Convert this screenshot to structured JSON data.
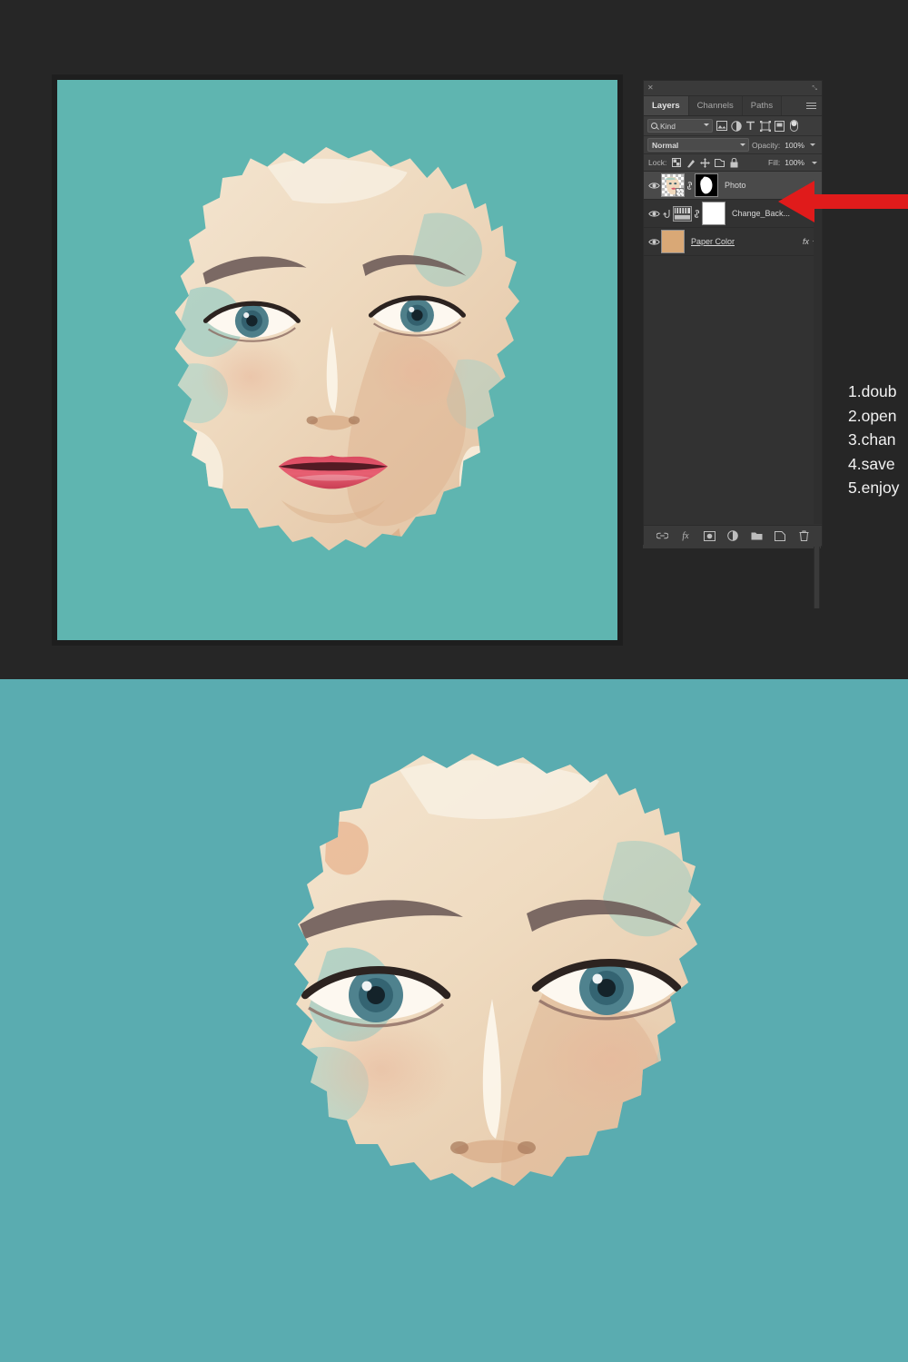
{
  "theme": {
    "app_background": "#262626",
    "canvas_teal": "#5fb5b0",
    "poster_teal": "#5aacb0",
    "panel_background": "#323232",
    "panel_header": "#3a3a3a",
    "selected_row": "#4a4a4a",
    "arrow_red": "#e01b1b",
    "paper_color_swatch": "#d9a876",
    "skin_light": "#f3e4cf",
    "skin_mid": "#e2bf9c",
    "lip_red": "#e2596b",
    "brow_dark": "#6b5a58"
  },
  "panel": {
    "name": "Layers",
    "close_glyph": "✕",
    "collapse_glyph": "⤡",
    "menu_icon": "hamburger-menu-icon",
    "tabs": [
      {
        "label": "Layers",
        "active": true
      },
      {
        "label": "Channels",
        "active": false
      },
      {
        "label": "Paths",
        "active": false
      }
    ],
    "filter_row": {
      "kind_label": "Kind",
      "search_icon": "magnifier-icon",
      "chevron": "chevron-down-icon",
      "filter_icons": [
        "pixel-layer-filter-icon",
        "adjustment-layer-filter-icon",
        "type-layer-filter-icon",
        "shape-layer-filter-icon",
        "smart-object-filter-icon"
      ],
      "toggle_icon": "filter-toggle-switch-icon"
    },
    "blend_row": {
      "blend_mode": "Normal",
      "opacity_label": "Opacity:",
      "opacity_value": "100%"
    },
    "lock_row": {
      "lock_label": "Lock:",
      "lock_icons": [
        "lock-transparent-pixels-icon",
        "lock-image-pixels-icon",
        "lock-position-icon",
        "lock-artboard-nesting-icon",
        "lock-all-icon"
      ],
      "fill_label": "Fill:",
      "fill_value": "100%"
    },
    "layers": [
      {
        "name": "Photo",
        "selected": true,
        "visible": true,
        "visibility_icon": "eye-icon",
        "thumbnail": "photo-layer-thumbnail",
        "link_icon": "link-icon",
        "mask": "layer-mask-thumbnail",
        "has_fx": false,
        "underline": false
      },
      {
        "name": "Change_Back...",
        "selected": false,
        "visible": true,
        "visibility_icon": "eye-icon",
        "thumbnail": "gradient-map-adjustment-thumbnail",
        "clip_icon": "clipping-mask-icon",
        "link_icon": "link-icon",
        "mask": "white-layer-mask-thumbnail",
        "has_fx": false,
        "underline": false
      },
      {
        "name": "Paper Color",
        "selected": false,
        "visible": true,
        "visibility_icon": "eye-icon",
        "thumbnail": "solid-color-swatch-thumbnail",
        "swatch_color": "#d9a876",
        "has_fx": true,
        "fx_label": "fx",
        "fx_chevron": "chevron-down-icon",
        "underline": true
      }
    ],
    "bottom_toolbar": [
      "link-layers-icon",
      "add-layer-style-fx-icon",
      "add-layer-mask-icon",
      "new-adjustment-layer-icon",
      "new-group-icon",
      "new-layer-icon",
      "delete-layer-icon"
    ]
  },
  "annotation": {
    "arrow": "left-pointing-red-arrow",
    "arrow_target": "Photo layer row",
    "steps": [
      "1.doub",
      "2.open",
      "3.chan",
      "4.save",
      "5.enjoy"
    ]
  },
  "artwork": {
    "title": "watercolor-portrait",
    "description": "Stylized watercolor portrait of a woman on teal background",
    "top_canvas": "editor-canvas-preview",
    "bottom_canvas": "final-result-preview"
  }
}
